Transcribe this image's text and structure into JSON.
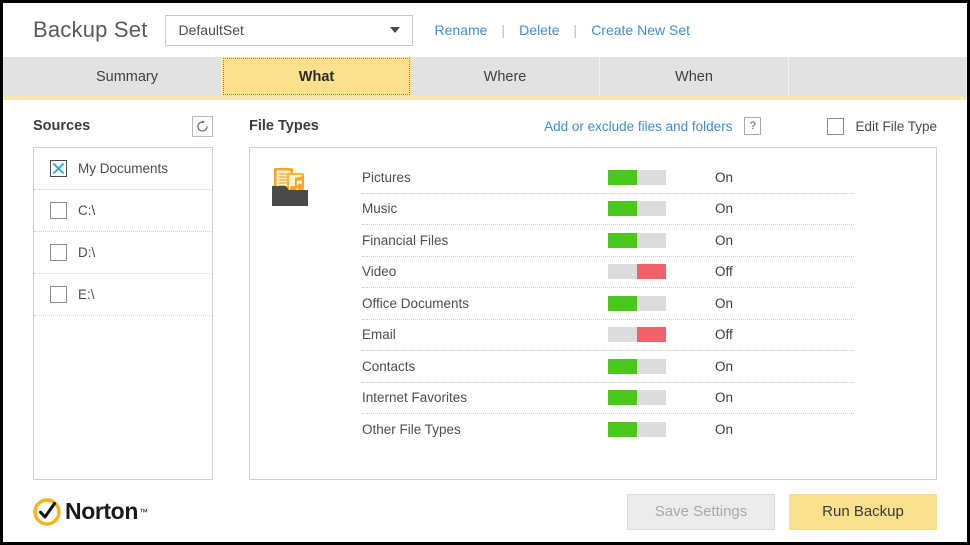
{
  "header": {
    "title": "Backup Set",
    "set_select": {
      "value": "DefaultSet",
      "icon": "chevron-down-icon"
    },
    "links": [
      {
        "label": "Rename"
      },
      {
        "label": "Delete"
      },
      {
        "label": "Create New Set"
      }
    ],
    "separator": "|"
  },
  "tabs": [
    {
      "label": "Summary",
      "active": false
    },
    {
      "label": "What",
      "active": true
    },
    {
      "label": "Where",
      "active": false
    },
    {
      "label": "When",
      "active": false
    }
  ],
  "sources": {
    "title": "Sources",
    "refresh_icon": "refresh-icon",
    "items": [
      {
        "label": "My Documents",
        "checked": true
      },
      {
        "label": "C:\\",
        "checked": false
      },
      {
        "label": "D:\\",
        "checked": false
      },
      {
        "label": "E:\\",
        "checked": false
      }
    ]
  },
  "file_types": {
    "title": "File Types",
    "add_exclude_link": "Add or exclude files and folders",
    "help_label": "?",
    "edit_file_type": {
      "label": "Edit File Type",
      "checked": false
    },
    "category_icon": "documents-music-folder-icon",
    "rows": [
      {
        "name": "Pictures",
        "state": "On",
        "enabled": true
      },
      {
        "name": "Music",
        "state": "On",
        "enabled": true
      },
      {
        "name": "Financial Files",
        "state": "On",
        "enabled": true
      },
      {
        "name": "Video",
        "state": "Off",
        "enabled": false
      },
      {
        "name": "Office Documents",
        "state": "On",
        "enabled": true
      },
      {
        "name": "Email",
        "state": "Off",
        "enabled": false
      },
      {
        "name": "Contacts",
        "state": "On",
        "enabled": true
      },
      {
        "name": "Internet Favorites",
        "state": "On",
        "enabled": true
      },
      {
        "name": "Other File Types",
        "state": "On",
        "enabled": true
      }
    ]
  },
  "footer": {
    "brand": "Norton",
    "brand_tm": "™",
    "save_label": "Save Settings",
    "save_disabled": true,
    "run_label": "Run Backup"
  },
  "colors": {
    "accent_yellow": "#fbe08e",
    "link_blue": "#3e8ecc",
    "toggle_on": "#4bc81e",
    "toggle_off": "#f2626b",
    "tab_bar": "#e2e2e2",
    "norton_gold": "#f5b31a"
  }
}
